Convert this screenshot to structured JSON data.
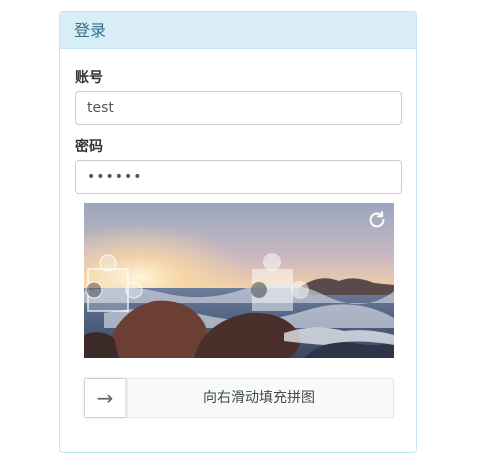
{
  "panel": {
    "title": "登录"
  },
  "account": {
    "label": "账号",
    "value": "test"
  },
  "password": {
    "label": "密码",
    "value": "••••••"
  },
  "slider": {
    "hint": "向右滑动填充拼图",
    "arrow": "→"
  },
  "icons": {
    "refresh": "refresh-icon",
    "arrow": "arrow-right-icon"
  }
}
